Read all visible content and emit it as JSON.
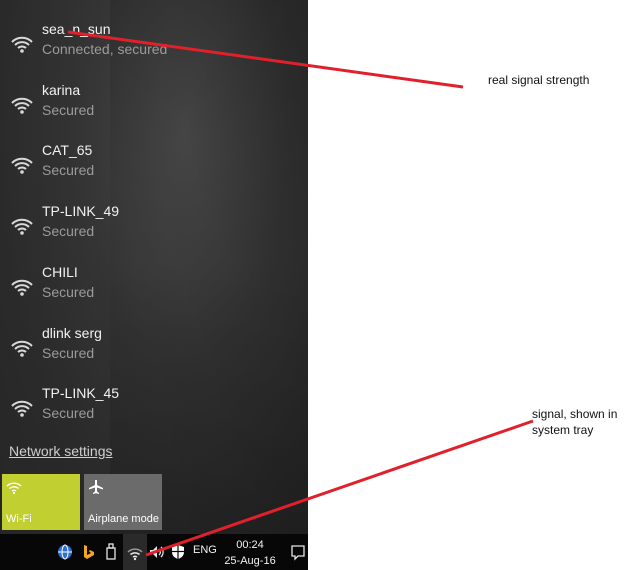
{
  "networks": [
    {
      "name": "sea_n_sun",
      "status": "Connected, secured"
    },
    {
      "name": "karina",
      "status": "Secured"
    },
    {
      "name": "CAT_65",
      "status": "Secured"
    },
    {
      "name": "TP-LINK_49",
      "status": "Secured"
    },
    {
      "name": "CHILI",
      "status": "Secured"
    },
    {
      "name": "dlink serg",
      "status": "Secured"
    },
    {
      "name": "TP-LINK_45",
      "status": "Secured"
    }
  ],
  "network_settings_label": "Network settings",
  "tiles": {
    "wifi_label": "Wi-Fi",
    "airplane_label": "Airplane mode"
  },
  "taskbar": {
    "language": "ENG",
    "time": "00:24",
    "date": "25-Aug-16"
  },
  "annotations": {
    "real_signal": "real signal strength",
    "tray_signal": "signal, shown in\nsystem tray"
  },
  "colors": {
    "wifi_tile": "#c1cf31",
    "airplane_tile": "#6b6b6b",
    "annotation_arrow": "#e0202a"
  }
}
